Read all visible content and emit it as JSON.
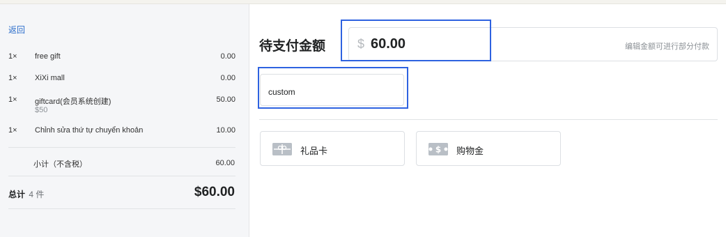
{
  "back_label": "返回",
  "cart": {
    "items": [
      {
        "qty": "1×",
        "name": "free gift",
        "price": "0.00",
        "sub": ""
      },
      {
        "qty": "1×",
        "name": "XiXi mall",
        "price": "0.00",
        "sub": ""
      },
      {
        "qty": "1×",
        "name": "giftcard(会员系统创建)",
        "price": "50.00",
        "sub": "$50"
      },
      {
        "qty": "1×",
        "name": "Chỉnh sửa thứ tự chuyển khoản",
        "price": "10.00",
        "sub": ""
      }
    ],
    "subtotal_label": "小计（不含税）",
    "subtotal_value": "60.00",
    "total_label": "总计",
    "total_count": "4 件",
    "total_value": "$60.00"
  },
  "payment": {
    "due_title": "待支付金额",
    "currency_symbol": "$",
    "amount": "60.00",
    "amount_hint": "编辑金额可进行部分付款",
    "custom_label": "custom",
    "methods": [
      {
        "label": "礼品卡",
        "icon": "gift-card-icon"
      },
      {
        "label": "购物金",
        "icon": "store-credit-icon"
      }
    ]
  },
  "colors": {
    "highlight": "#2e62e0",
    "link": "#2c6ecb",
    "panel_bg": "#f5f6f8"
  }
}
